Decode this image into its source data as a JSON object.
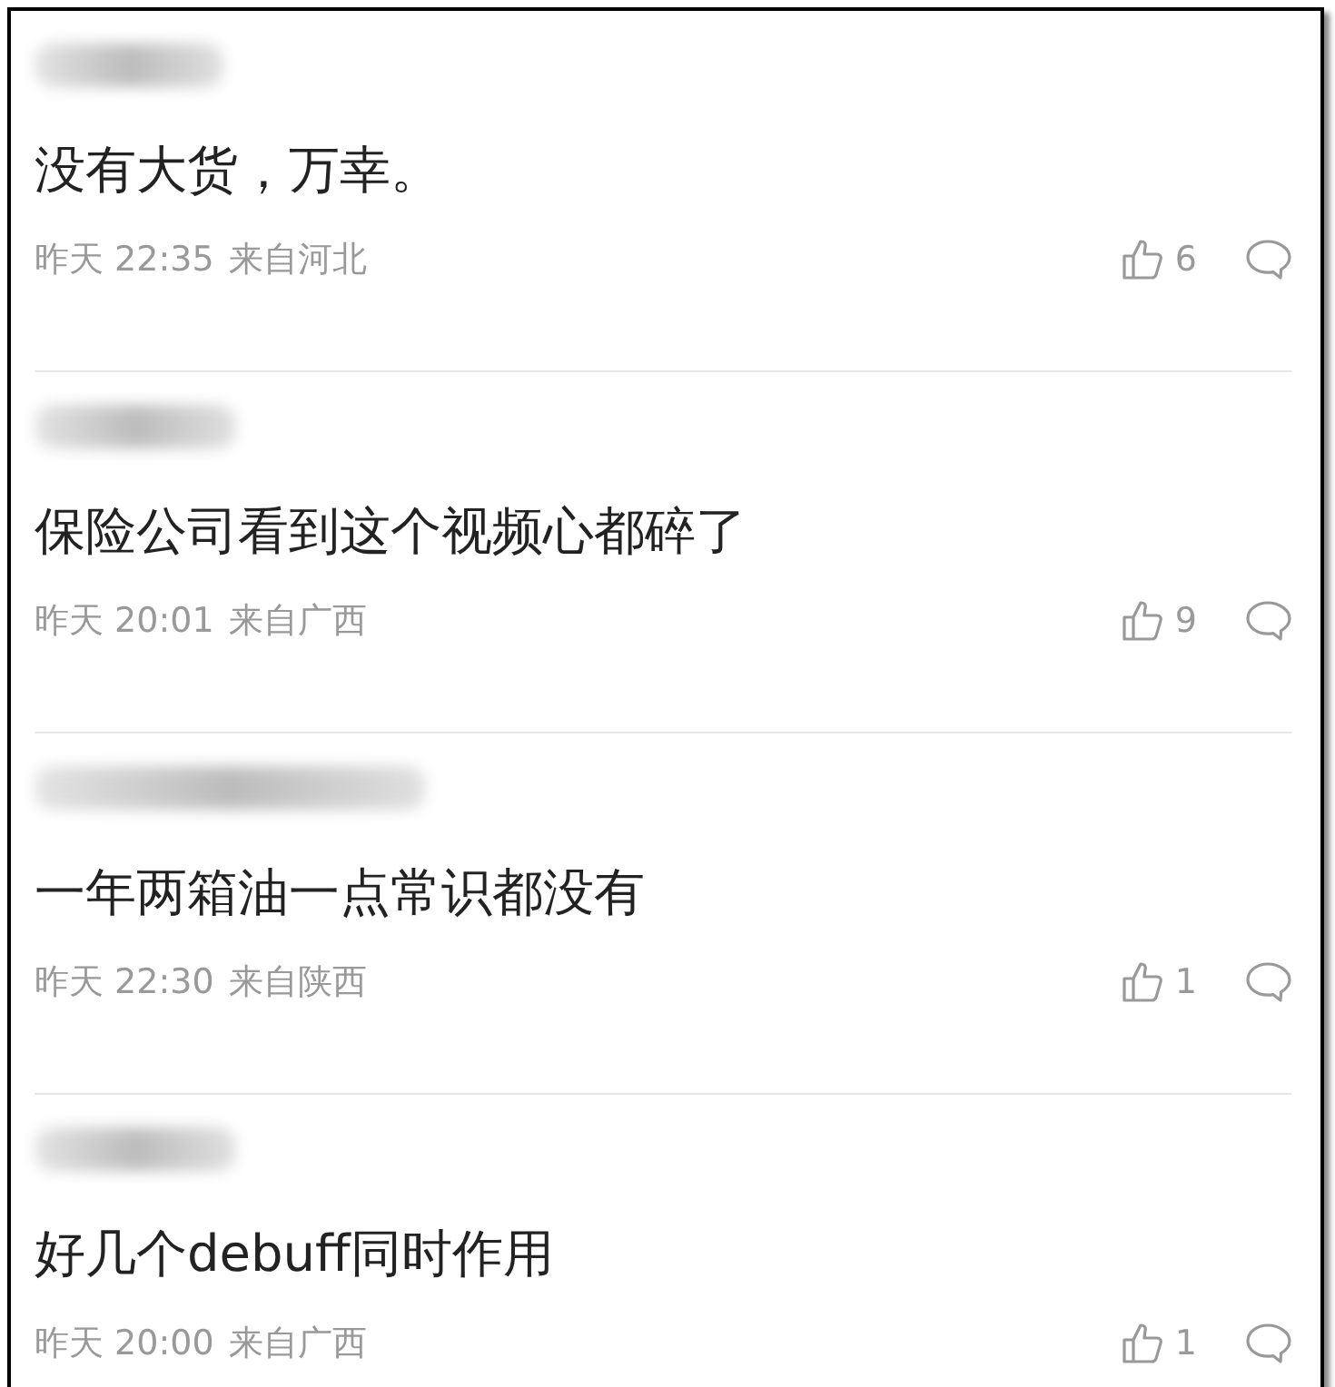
{
  "comments": [
    {
      "text": "没有大货，万幸。",
      "time": "昨天 22:35",
      "location": "来自河北",
      "likes": "6"
    },
    {
      "text": "保险公司看到这个视频心都碎了",
      "time": "昨天 20:01",
      "location": "来自广西",
      "likes": "9"
    },
    {
      "text": "一年两箱油一点常识都没有",
      "time": "昨天 22:30",
      "location": "来自陕西",
      "likes": "1"
    },
    {
      "text": "好几个debuff同时作用",
      "time": "昨天 20:00",
      "location": "来自广西",
      "likes": "1"
    }
  ]
}
